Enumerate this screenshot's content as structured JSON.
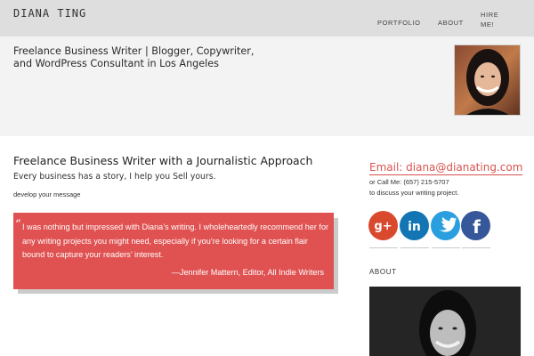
{
  "site": {
    "title": "DIANA TING"
  },
  "nav": {
    "items": [
      {
        "label": "PORTFOLIO"
      },
      {
        "label": "ABOUT"
      },
      {
        "label": "HIRE ME!"
      }
    ]
  },
  "hero": {
    "tagline": "Freelance Business Writer | Blogger, Copywriter, and WordPress Consultant in Los Angeles"
  },
  "intro": {
    "heading": "Freelance Business Writer with a Journalistic Approach",
    "subheading": "Every business has a story, I help you Sell yours.",
    "cta_label": "develop your message"
  },
  "testimonial": {
    "quote_mark": "“",
    "text": "I was nothing but impressed with Diana’s writing. I wholeheartedly recommend her for any writing projects you might need, especially if you’re looking for a certain flair bound to capture your readers’ interest.",
    "attribution": "—Jennifer Mattern, Editor, All Indie Writers",
    "background_color": "#e05151"
  },
  "contact": {
    "email_label": "Email: diana@dianating.com",
    "call_label": "or Call Me: (657) 215-5707",
    "note": "to discuss your writing project."
  },
  "social": [
    {
      "icon": "google-plus-icon",
      "glyph": "g+",
      "color": "#d9492e"
    },
    {
      "icon": "linkedin-icon",
      "glyph": "in",
      "color": "#1375b3"
    },
    {
      "icon": "twitter-icon",
      "glyph": "",
      "color": "#2a9fe0"
    },
    {
      "icon": "facebook-icon",
      "glyph": "f",
      "color": "#365799"
    }
  ],
  "about": {
    "heading": "ABOUT"
  },
  "colors": {
    "accent": "#d9534f",
    "topbar": "#dedede",
    "hero_band": "#f3f3f3"
  }
}
